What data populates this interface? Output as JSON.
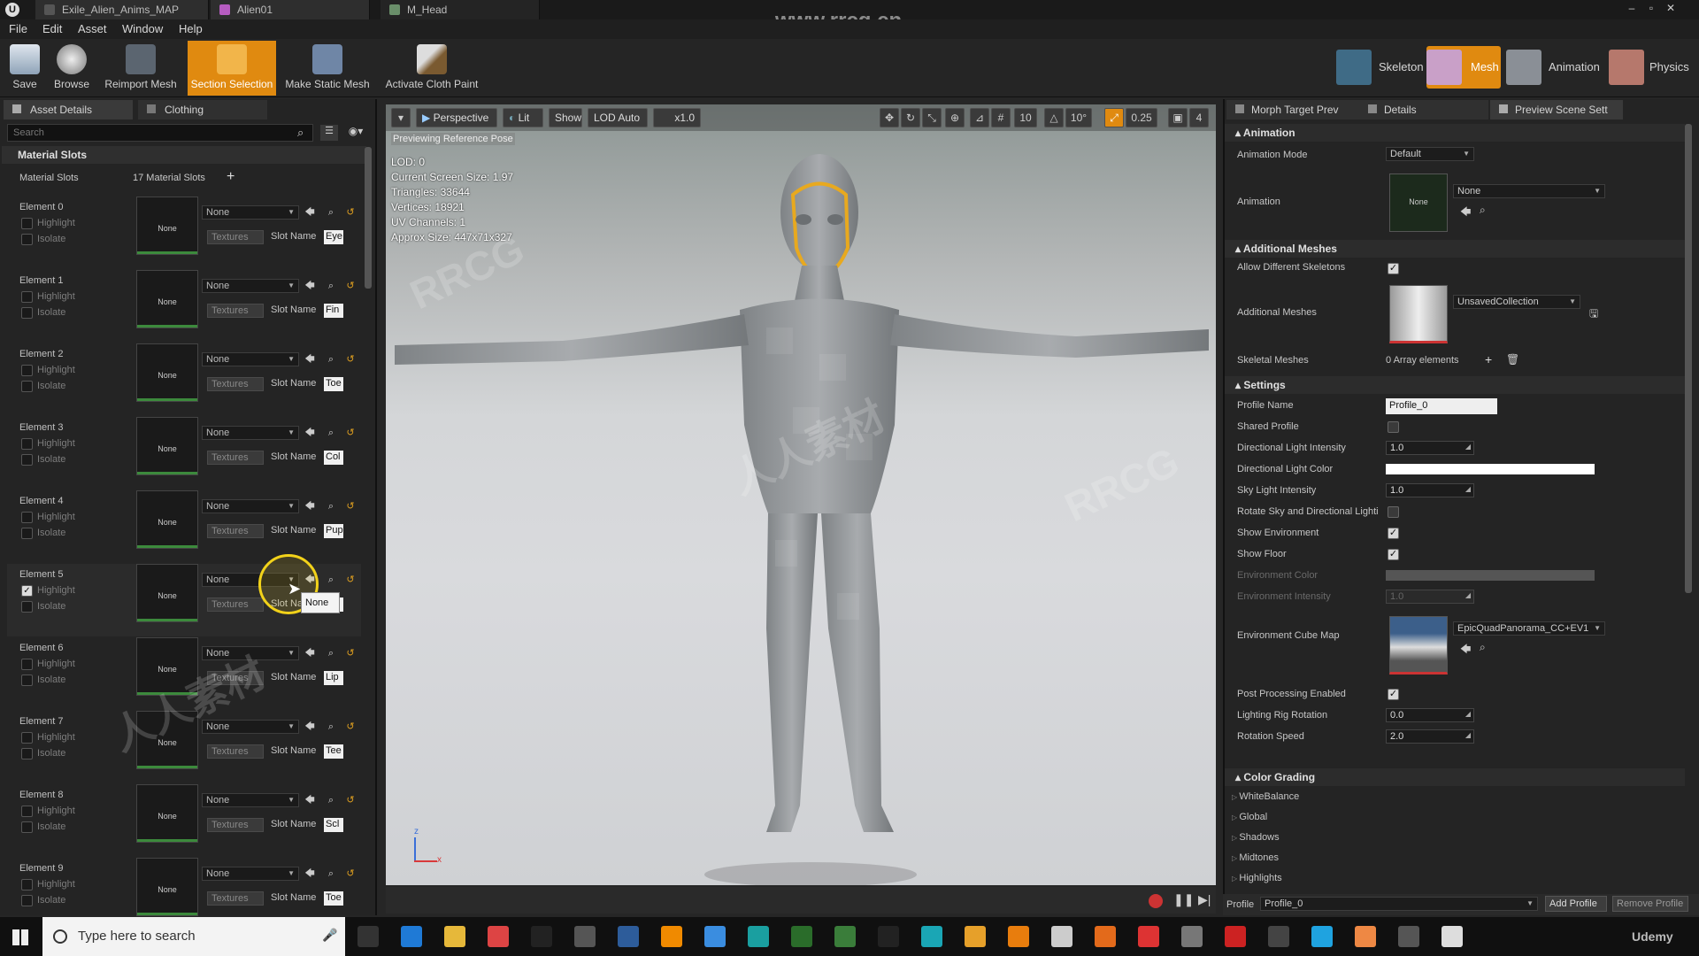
{
  "titlebar": {
    "tabs": [
      "Exile_Alien_Anims_MAP",
      "Alien01",
      "M_Head"
    ],
    "watermark_url": "www.rrcg.cn"
  },
  "menu": [
    "File",
    "Edit",
    "Asset",
    "Window",
    "Help"
  ],
  "toolbar": {
    "buttons": [
      "Save",
      "Browse",
      "Reimport Mesh",
      "Section Selection",
      "Make Static Mesh",
      "Activate Cloth Paint"
    ],
    "modes": [
      "Skeleton",
      "Mesh",
      "Animation",
      "Physics"
    ]
  },
  "left": {
    "tabs": [
      "Asset Details",
      "Clothing"
    ],
    "search_placeholder": "Search",
    "section": "Material Slots",
    "slots_label": "Material Slots",
    "slots_count": "17 Material Slots",
    "elements": [
      {
        "name": "Element 0",
        "mat": "None",
        "slot": "Eye",
        "highlight": false
      },
      {
        "name": "Element 1",
        "mat": "None",
        "slot": "Fin",
        "highlight": false
      },
      {
        "name": "Element 2",
        "mat": "None",
        "slot": "Toe",
        "highlight": false
      },
      {
        "name": "Element 3",
        "mat": "None",
        "slot": "Col",
        "highlight": false
      },
      {
        "name": "Element 4",
        "mat": "None",
        "slot": "Pup",
        "highlight": false
      },
      {
        "name": "Element 5",
        "mat": "None",
        "slot": "",
        "highlight": true
      },
      {
        "name": "Element 6",
        "mat": "None",
        "slot": "Lip",
        "highlight": false
      },
      {
        "name": "Element 7",
        "mat": "None",
        "slot": "Tee",
        "highlight": false
      },
      {
        "name": "Element 8",
        "mat": "None",
        "slot": "Scl",
        "highlight": false
      },
      {
        "name": "Element 9",
        "mat": "None",
        "slot": "Toe",
        "highlight": false
      }
    ],
    "highlight_label": "Highlight",
    "isolate_label": "Isolate",
    "textures_label": "Textures",
    "slot_name_label": "Slot Name",
    "thumb_label": "None",
    "tooltip": "None"
  },
  "viewport": {
    "perspective": "Perspective",
    "lit": "Lit",
    "show": "Show",
    "lod": "LOD Auto",
    "speed": "x1.0",
    "grid": "10",
    "angle": "10°",
    "scale": "0.25",
    "camspeed": "4",
    "preview_text": "Previewing Reference Pose",
    "stats": [
      "LOD: 0",
      "Current Screen Size: 1.97",
      "Triangles: 33644",
      "Vertices: 18921",
      "UV Channels: 1",
      "Approx Size: 447x71x327"
    ]
  },
  "right": {
    "tabs": [
      "Morph Target Prev",
      "Details",
      "Preview Scene Sett"
    ],
    "animation": {
      "section": "Animation",
      "mode_label": "Animation Mode",
      "mode_value": "Default",
      "anim_label": "Animation",
      "anim_value": "None",
      "thumb": "None"
    },
    "additional": {
      "section": "Additional Meshes",
      "allow_label": "Allow Different Skeletons",
      "meshes_label": "Additional Meshes",
      "meshes_value": "UnsavedCollection",
      "skeletal_label": "Skeletal Meshes",
      "skeletal_value": "0 Array elements"
    },
    "settings": {
      "section": "Settings",
      "rows": [
        {
          "label": "Profile Name",
          "value": "Profile_0"
        },
        {
          "label": "Shared Profile",
          "value": ""
        },
        {
          "label": "Directional Light Intensity",
          "value": "1.0"
        },
        {
          "label": "Directional Light Color",
          "value": ""
        },
        {
          "label": "Sky Light Intensity",
          "value": "1.0"
        },
        {
          "label": "Rotate Sky and Directional Lighti",
          "value": ""
        },
        {
          "label": "Show Environment",
          "value": ""
        },
        {
          "label": "Show Floor",
          "value": ""
        },
        {
          "label": "Environment Color",
          "value": ""
        },
        {
          "label": "Environment Intensity",
          "value": "1.0"
        },
        {
          "label": "Environment Cube Map",
          "value": "EpicQuadPanorama_CC+EV1"
        },
        {
          "label": "Post Processing Enabled",
          "value": ""
        },
        {
          "label": "Lighting Rig Rotation",
          "value": "0.0"
        },
        {
          "label": "Rotation Speed",
          "value": "2.0"
        }
      ]
    },
    "grading": {
      "section": "Color Grading",
      "items": [
        "WhiteBalance",
        "Global",
        "Shadows",
        "Midtones",
        "Highlights"
      ]
    },
    "profile": {
      "label": "Profile",
      "value": "Profile_0",
      "add": "Add Profile",
      "remove": "Remove Profile"
    }
  },
  "taskbar": {
    "search_placeholder": "Type here to search",
    "udemy": "Udemy"
  },
  "watermarks": [
    "RRCG",
    "人人素材"
  ]
}
